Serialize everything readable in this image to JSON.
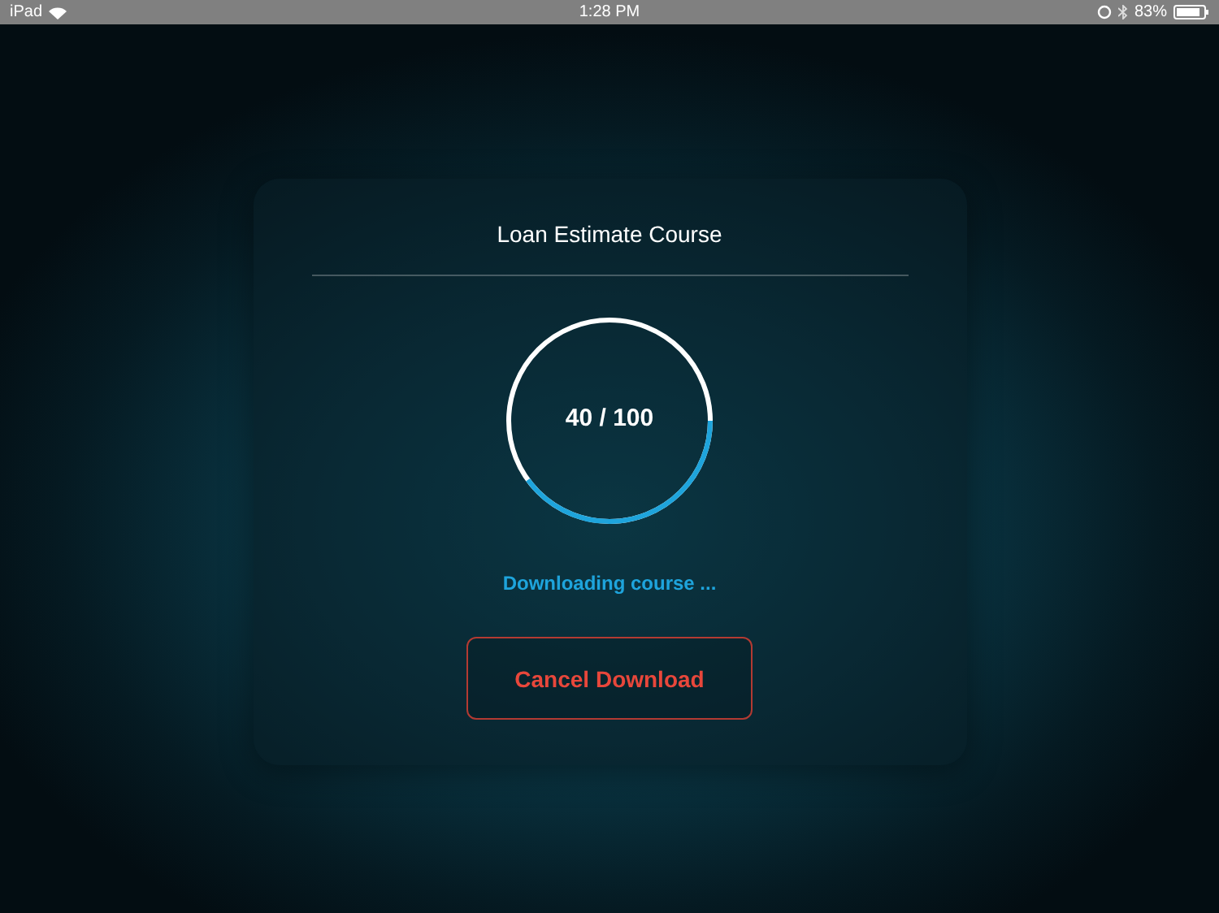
{
  "status_bar": {
    "device": "iPad",
    "time": "1:28 PM",
    "battery": "83%"
  },
  "dialog": {
    "title": "Loan Estimate Course",
    "progress": {
      "text": "40 / 100",
      "level": 0.4
    },
    "message": "Downloading course ...",
    "button": "Cancel Download"
  }
}
